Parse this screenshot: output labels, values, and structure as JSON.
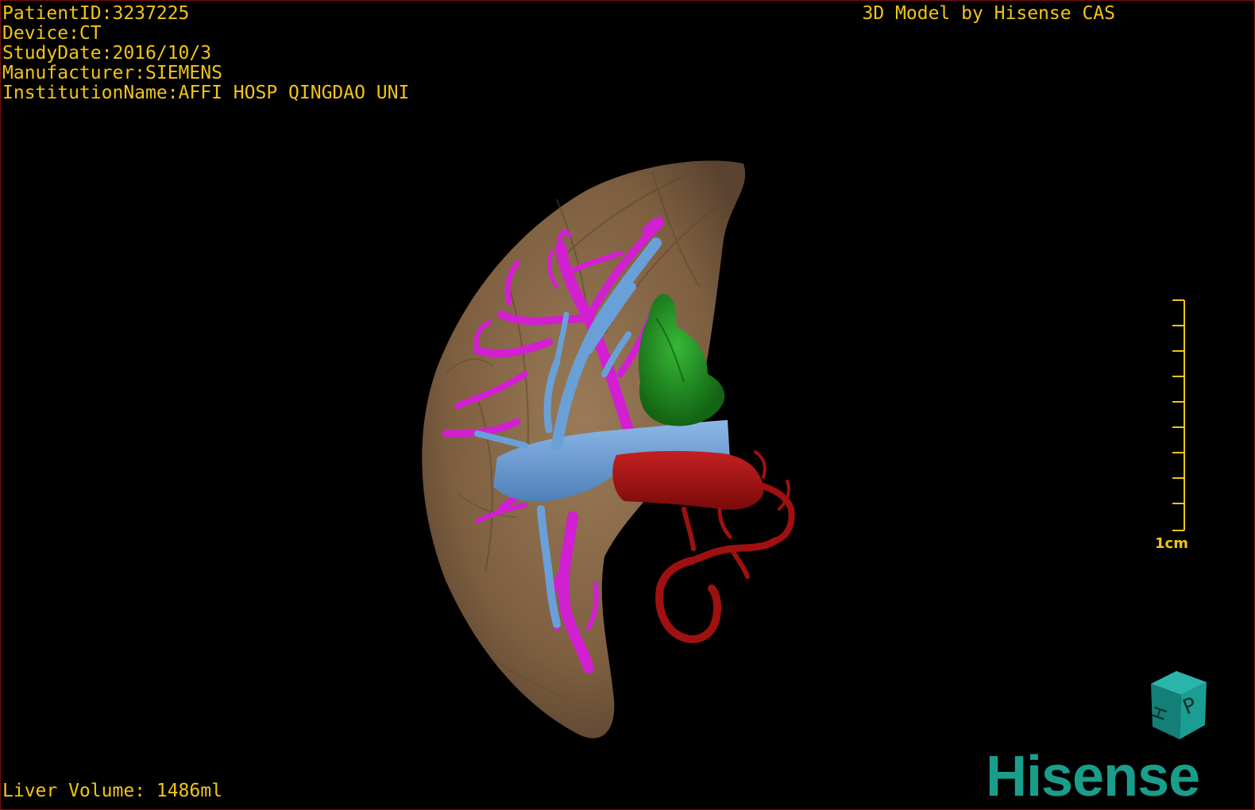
{
  "patient_info": {
    "patient_id": "PatientID:3237225",
    "device": "Device:CT",
    "study_date": "StudyDate:2016/10/3",
    "manufacturer": "Manufacturer:SIEMENS",
    "institution": "InstitutionName:AFFI HOSP QINGDAO UNI"
  },
  "model_credit": "3D Model by Hisense CAS",
  "liver_volume": "Liver Volume: 1486ml",
  "scale": {
    "label": "1cm"
  },
  "orientation_cube": {
    "face_front": "P",
    "face_side": "H",
    "color": "#1a9e94"
  },
  "brand": {
    "name": "Hisense",
    "color": "#1a9e8c"
  },
  "colors": {
    "overlay_text": "#f0c419",
    "liver": "#8b6b48",
    "hepatic_vein": "#d21fd2",
    "portal_vein": "#6aa0d8",
    "gallbladder": "#1f8f1f",
    "artery": "#a01010",
    "background": "#000000"
  }
}
